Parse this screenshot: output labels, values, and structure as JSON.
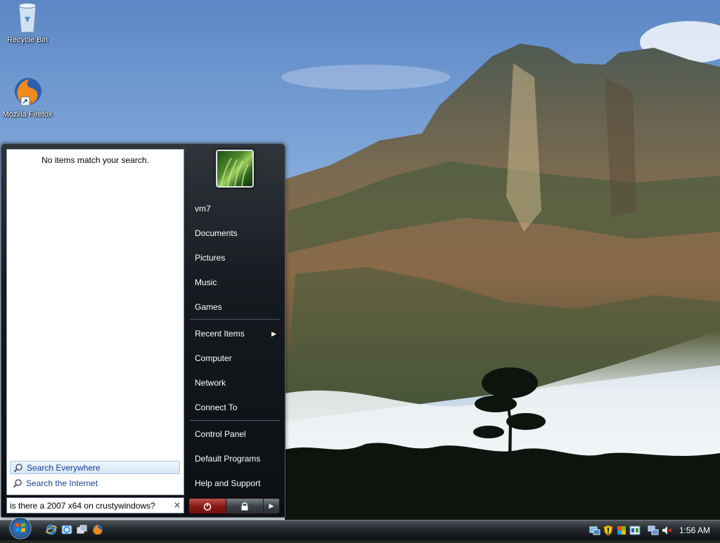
{
  "desktop": {
    "icons": [
      {
        "label": "Recycle Bin",
        "icon": "recycle-bin-icon"
      },
      {
        "label": "Mozilla Firefox",
        "icon": "firefox-icon"
      }
    ]
  },
  "start_menu": {
    "no_results_text": "No items match your search.",
    "search_links": [
      {
        "label": "Search Everywhere",
        "selected": true
      },
      {
        "label": "Search the Internet",
        "selected": false
      }
    ],
    "search": {
      "value": "is there a 2007 x64 on crustywindows?",
      "clear_glyph": "×"
    },
    "right_items": [
      {
        "label": "vm7"
      },
      {
        "label": "Documents"
      },
      {
        "label": "Pictures"
      },
      {
        "label": "Music"
      },
      {
        "label": "Games"
      },
      {
        "label": "Recent Items",
        "has_submenu": true
      },
      {
        "label": "Computer"
      },
      {
        "label": "Network"
      },
      {
        "label": "Connect To"
      },
      {
        "label": "Control Panel"
      },
      {
        "label": "Default Programs"
      },
      {
        "label": "Help and Support"
      }
    ],
    "power": {
      "power_icon": "power-icon",
      "lock_icon": "lock-icon",
      "options_glyph": "▶"
    }
  },
  "taskbar": {
    "start_icon": "windows-orb-icon",
    "quick_launch": [
      "internet-explorer-icon",
      "internet-explorer-alt-icon",
      "switch-windows-icon",
      "firefox-icon"
    ],
    "tray_icons": [
      "network-status-icon",
      "security-shield-icon",
      "windows-update-icon",
      "language-icon",
      "network-icon",
      "volume-muted-icon"
    ],
    "clock": "1:56 AM"
  },
  "colors": {
    "accent": "#1e3f8f",
    "menu_bg": "#151a1f",
    "power_red": "#8a1a16"
  }
}
